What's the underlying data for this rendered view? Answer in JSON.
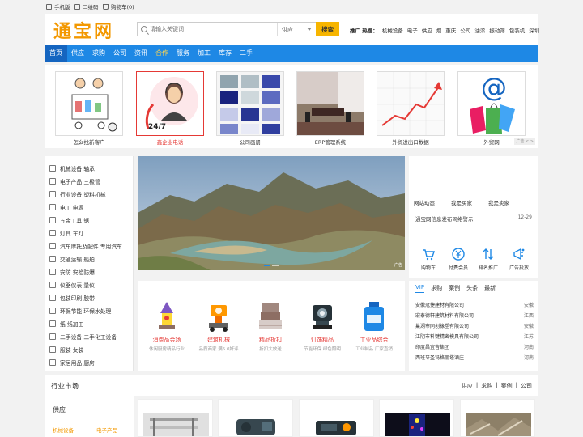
{
  "topbar": {
    "mobile": "手机版",
    "qrcode": "二维码",
    "cart": "购物车(0)"
  },
  "header": {
    "logo": "通宝网",
    "search_placeholder": "请输入关键词",
    "search_scope": "供应",
    "search_button": "搜索",
    "hot_label": "推广 热搜：",
    "hot_items": [
      "机械设备",
      "电子",
      "供应",
      "烟",
      "重庆",
      "公司",
      "油漆",
      "振动筛",
      "包装机",
      "深圳"
    ]
  },
  "nav": {
    "items": [
      "首页",
      "供应",
      "求购",
      "公司",
      "资讯",
      "合作",
      "服务",
      "加工",
      "库存",
      "二手"
    ]
  },
  "strip": {
    "items": [
      {
        "caption": "怎么找新客户",
        "color": "normal"
      },
      {
        "caption": "鑫企业电话",
        "color": "red",
        "badge": "24/7"
      },
      {
        "caption": "公司画册",
        "color": "normal"
      },
      {
        "caption": "ERP管理系统",
        "color": "normal"
      },
      {
        "caption": "外贸进出口数据",
        "color": "normal"
      },
      {
        "caption": "外贸网",
        "color": "normal"
      }
    ],
    "pager": "广告 < >"
  },
  "categories": [
    "机械设备 轴承",
    "电子产品 三极管",
    "行业设备 塑料机械",
    "电工 电源",
    "五金工具 锯",
    "灯具 车灯",
    "汽车摩托及配件 专用汽车",
    "交通运输 船舶",
    "安防 安检防爆",
    "仪器仪表 量仪",
    "包装印刷 胶带",
    "环保节能 环保水处理",
    "纸 纸加工",
    "二手设备 二手化工设备",
    "服装 女装",
    "家居用品 厨房"
  ],
  "banner": {
    "ad_label": "广告"
  },
  "right_panel": {
    "tabs": [
      "网站动态",
      "我是买家",
      "我是卖家"
    ],
    "news": {
      "title": "通宝网信息发布网络警示",
      "date": "12-29"
    },
    "quick": [
      {
        "label": "购物车",
        "icon": "cart-icon"
      },
      {
        "label": "付费会员",
        "icon": "yen-icon"
      },
      {
        "label": "排名推广",
        "icon": "rank-icon"
      },
      {
        "label": "广告投放",
        "icon": "ad-icon"
      }
    ]
  },
  "featured": [
    {
      "title": "消费品会场",
      "sub": "休闲厨房精品行业"
    },
    {
      "title": "建筑机械",
      "sub": "品质商家 满5.0好评"
    },
    {
      "title": "精品折扣",
      "sub": "折扣大放送"
    },
    {
      "title": "灯饰精品",
      "sub": "节能环保 绿色照明"
    },
    {
      "title": "工业品综合",
      "sub": "工业制品 厂家直销"
    }
  ],
  "vip": {
    "tabs": [
      "VIP",
      "求购",
      "案例",
      "头条",
      "最新"
    ],
    "rows": [
      {
        "name": "安徽冠捷建材有限公司",
        "loc": "安徽"
      },
      {
        "name": "宏泰德轩建筑材料有限公司",
        "loc": "江西"
      },
      {
        "name": "巢湖市同创橡塑有限公司",
        "loc": "安徽"
      },
      {
        "name": "江阴市科键精密模具有限公司",
        "loc": "江苏"
      },
      {
        "name": "印度昌宜吉集团",
        "loc": "河南"
      },
      {
        "name": "西班牙圣玛格丽塔酒庄",
        "loc": "河南"
      }
    ]
  },
  "market": {
    "title": "行业市场",
    "links": [
      "供应",
      "|",
      "求购",
      "|",
      "案例",
      "|",
      "公司"
    ],
    "supply_title": "供应",
    "supply_links": [
      "机械设备",
      "电子产品"
    ]
  },
  "colors": {
    "brand_orange": "#f39800",
    "nav_blue": "#1e88e5",
    "search_yellow": "#f7b500",
    "accent_red": "#e53935"
  }
}
